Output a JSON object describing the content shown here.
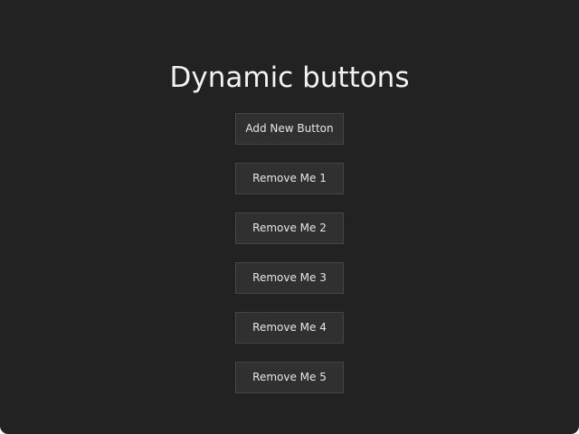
{
  "page": {
    "title": "Dynamic buttons"
  },
  "buttons": {
    "add_label": "Add New Button",
    "remove": [
      {
        "label": "Remove Me 1"
      },
      {
        "label": "Remove Me 2"
      },
      {
        "label": "Remove Me 3"
      },
      {
        "label": "Remove Me 4"
      },
      {
        "label": "Remove Me 5"
      }
    ]
  },
  "colors": {
    "background": "#222222",
    "button_background": "#303030",
    "button_border": "#454545",
    "text": "#f2f2f2"
  }
}
